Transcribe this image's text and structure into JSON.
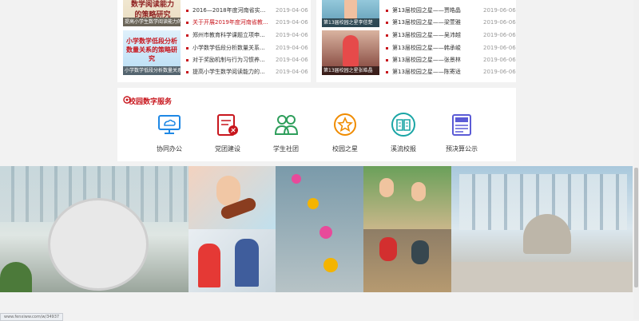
{
  "news_left": {
    "thumbs": [
      {
        "caption": "提高小学生数学阅读能力的策略研究",
        "overlay": "数学阅读能力的策略研究"
      },
      {
        "caption": "小学数学低段分析数量关系的策略研究",
        "overlay": "小学数学低段分析数量关系的策略研究"
      }
    ],
    "items": [
      {
        "title": "2016—2018年度河南省实...",
        "date": "2019-04-06"
      },
      {
        "title": "关于开展2019年度河南省教...",
        "date": "2019-04-06",
        "highlight": true
      },
      {
        "title": "郑州市教育科学课题立项申...",
        "date": "2019-04-06"
      },
      {
        "title": "小学数学低段分析数量关系...",
        "date": "2019-04-06"
      },
      {
        "title": "对于奖励机制与行为习惯养...",
        "date": "2019-04-06"
      },
      {
        "title": "提高小学生数学阅读能力的...",
        "date": "2019-04-06"
      }
    ]
  },
  "news_right": {
    "thumbs": [
      {
        "caption": "第13届校园之星李信楚"
      },
      {
        "caption": "第13届校园之星张皓晶"
      }
    ],
    "items": [
      {
        "title": "第13届校园之星——贾皓晶",
        "date": "2019-06-06"
      },
      {
        "title": "第13届校园之星——梁萱雅",
        "date": "2019-06-06"
      },
      {
        "title": "第13届校园之星——吴沛越",
        "date": "2019-06-06"
      },
      {
        "title": "第13届校园之星——韩承峻",
        "date": "2019-06-06"
      },
      {
        "title": "第13届校园之星——张景林",
        "date": "2019-06-06"
      },
      {
        "title": "第13届校园之星——陈寄适",
        "date": "2019-06-06"
      }
    ]
  },
  "services": {
    "title": "校园数字服务",
    "items": [
      {
        "label": "协同办公",
        "icon": "cloud-monitor-icon",
        "color": "#1e88e5"
      },
      {
        "label": "党团建设",
        "icon": "party-flag-icon",
        "color": "#c8161d"
      },
      {
        "label": "学生社团",
        "icon": "people-icon",
        "color": "#2e9e5b"
      },
      {
        "label": "校园之星",
        "icon": "star-circle-icon",
        "color": "#f08c00"
      },
      {
        "label": "溪流校报",
        "icon": "open-book-icon",
        "color": "#1aa5a5"
      },
      {
        "label": "预决算公示",
        "icon": "newspaper-icon",
        "color": "#5b5bd6"
      }
    ]
  },
  "statusbar": {
    "url": "www.fenxiww.com/w/34937"
  },
  "colors": {
    "accent": "#c8161d",
    "page_bg": "#f2f2f2"
  }
}
